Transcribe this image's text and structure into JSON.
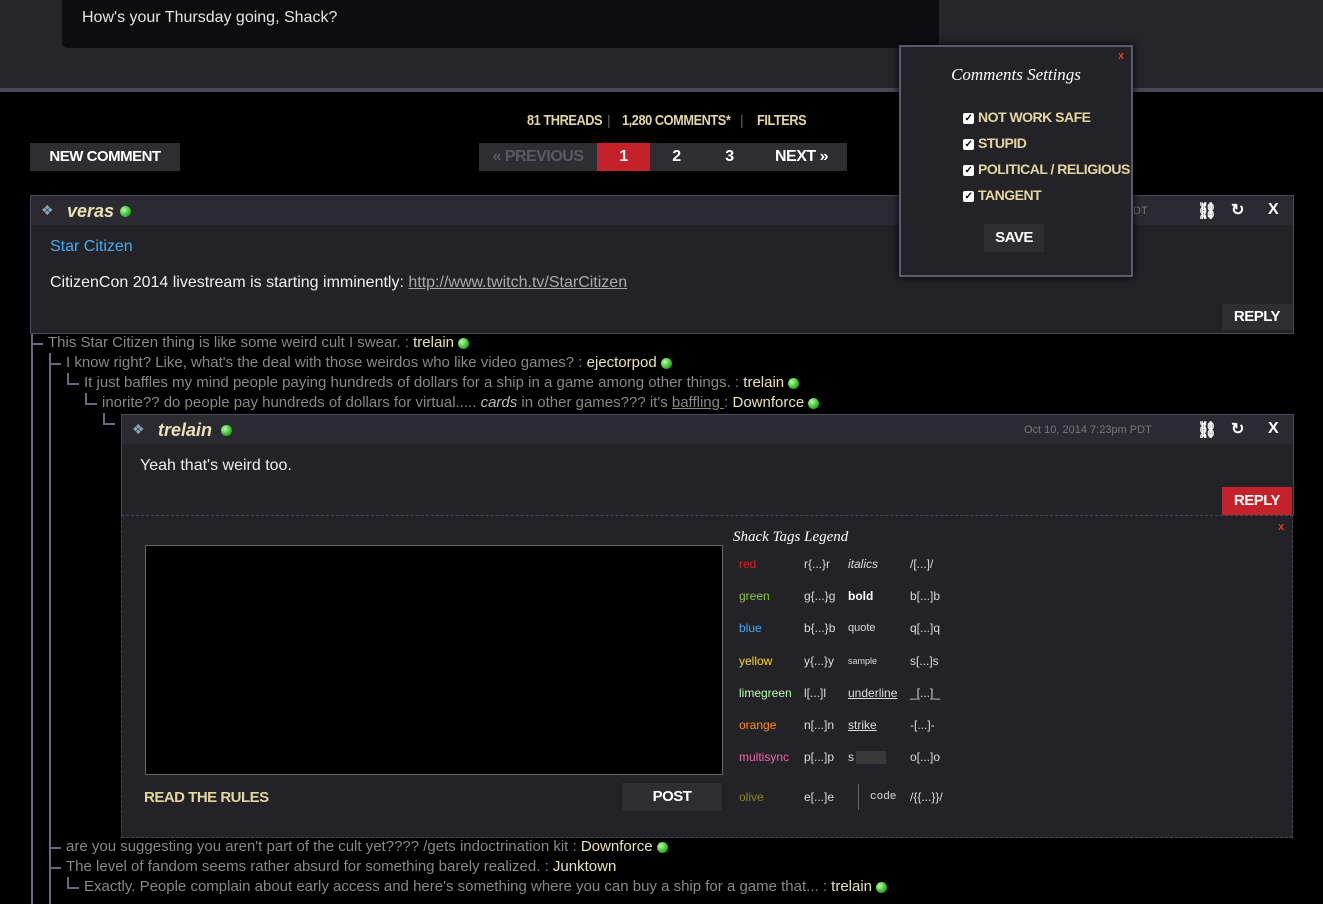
{
  "top_message": "How's your Thursday going, Shack?",
  "stats": {
    "threads": "81 THREADS",
    "comments": "1,280 COMMENTS*",
    "filters": "FILTERS",
    "separator": "|"
  },
  "new_comment_label": "NEW COMMENT",
  "pagination": {
    "previous": "« PREVIOUS",
    "pages": [
      "1",
      "2",
      "3"
    ],
    "current": "1",
    "next": "NEXT »"
  },
  "root_post": {
    "author": "veras",
    "date_partial": "DT",
    "category": "Star Citizen",
    "body_text": "CitizenCon 2014 livestream is starting imminently: ",
    "link": "http://www.twitch.tv/StarCitizen",
    "reply_label": "REPLY"
  },
  "thread_lines": [
    {
      "text": "This Star Citizen thing is like some weird cult I swear. : ",
      "author": "trelain"
    },
    {
      "text": "I know right? Like, what's the deal with those weirdos who like video games? : ",
      "author": "ejectorpod"
    },
    {
      "text": "It just baffles my mind people paying hundreds of dollars for a ship in a game among other things. : ",
      "author": "trelain"
    },
    {
      "text_a": "inorite?? do people pay hundreds of dollars for virtual..... ",
      "text_italic": "cards",
      "text_b": " in other games??? it's ",
      "text_underline": "baffling ",
      "text_c": ": ",
      "author": "Downforce"
    }
  ],
  "reply_post": {
    "author": "trelain",
    "date": "Oct 10, 2014 7:23pm PDT",
    "body_text": "Yeah that's weird too.",
    "reply_label": "REPLY"
  },
  "thread_lines_after": [
    {
      "text": "are you suggesting you aren't part of the cult yet???? /gets indoctrination kit : ",
      "author": "Downforce"
    },
    {
      "text": "The level of fandom seems rather absurd for something barely realized. : ",
      "author": "Junktown"
    },
    {
      "text": "Exactly. People complain about early access and here's something where you can buy a ship for a game that... : ",
      "author": "trelain"
    }
  ],
  "settings": {
    "title": "Comments Settings",
    "close": "x",
    "options": [
      "NOT WORK SAFE",
      "STUPID",
      "POLITICAL / RELIGIOUS",
      "TANGENT"
    ],
    "save_label": "SAVE"
  },
  "composer": {
    "close": "x",
    "read_rules": "READ THE RULES",
    "post_label": "POST",
    "legend_title": "Shack Tags Legend",
    "legend_colors": [
      {
        "name": "red",
        "tag": "r{...}r",
        "color": "#e02020"
      },
      {
        "name": "green",
        "tag": "g{...}g",
        "color": "#8dc63f"
      },
      {
        "name": "blue",
        "tag": "b{...}b",
        "color": "#44aaee"
      },
      {
        "name": "yellow",
        "tag": "y{...}y",
        "color": "#ffd42a"
      },
      {
        "name": "limegreen",
        "tag": "l[...]l",
        "color": "#b6ffb0"
      },
      {
        "name": "orange",
        "tag": "n[...]n",
        "color": "#ff8c1a"
      },
      {
        "name": "multisync",
        "tag": "p[...]p",
        "color": "#ee66aa"
      },
      {
        "name": "olive",
        "tag": "e[...]e",
        "color": "#888822"
      }
    ],
    "legend_styles": [
      {
        "name": "italics",
        "tag": "/[...]/"
      },
      {
        "name": "bold",
        "tag": "b[...]b"
      },
      {
        "name": "quote",
        "tag": "q[...]q"
      },
      {
        "name": "sample",
        "tag": "s[...]s"
      },
      {
        "name": "underline",
        "tag": "_[...]_"
      },
      {
        "name": "strike",
        "tag": "-[...]-"
      },
      {
        "name": "s",
        "tag": "o[...]o"
      },
      {
        "name": "code",
        "tag": "/{{...}}/"
      }
    ]
  }
}
